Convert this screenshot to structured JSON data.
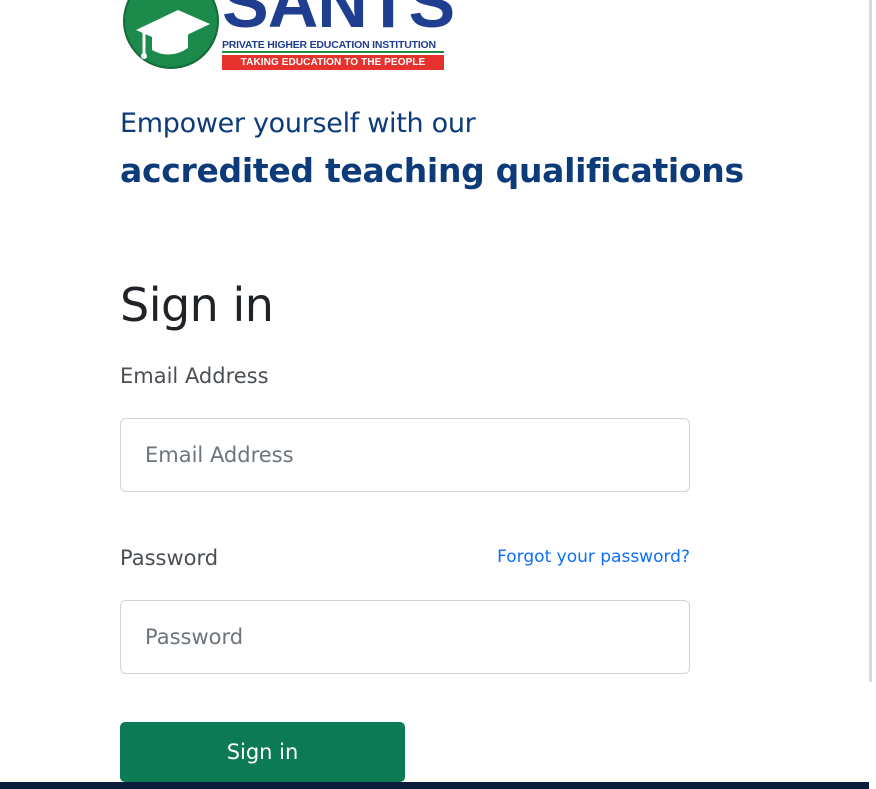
{
  "logo": {
    "wordmark": "SANTS",
    "subtitle": "PRIVATE HIGHER EDUCATION INSTITUTION",
    "tagline": "TAKING EDUCATION TO THE PEOPLE",
    "colors": {
      "green": "#1b8a4a",
      "blue": "#1f3e8f",
      "red": "#e5322d"
    }
  },
  "hero": {
    "line1": "Empower yourself with our",
    "line2": "accredited teaching qualifications"
  },
  "form": {
    "title": "Sign in",
    "email": {
      "label": "Email Address",
      "placeholder": "Email Address",
      "value": ""
    },
    "password": {
      "label": "Password",
      "placeholder": "Password",
      "value": "",
      "forgot_link": "Forgot your password?"
    },
    "submit_label": "Sign in"
  },
  "colors": {
    "heading_blue": "#0d3b7a",
    "link_blue": "#0d6efd",
    "button_green": "#0b7a55",
    "bottom_bar": "#0c1c3b"
  }
}
